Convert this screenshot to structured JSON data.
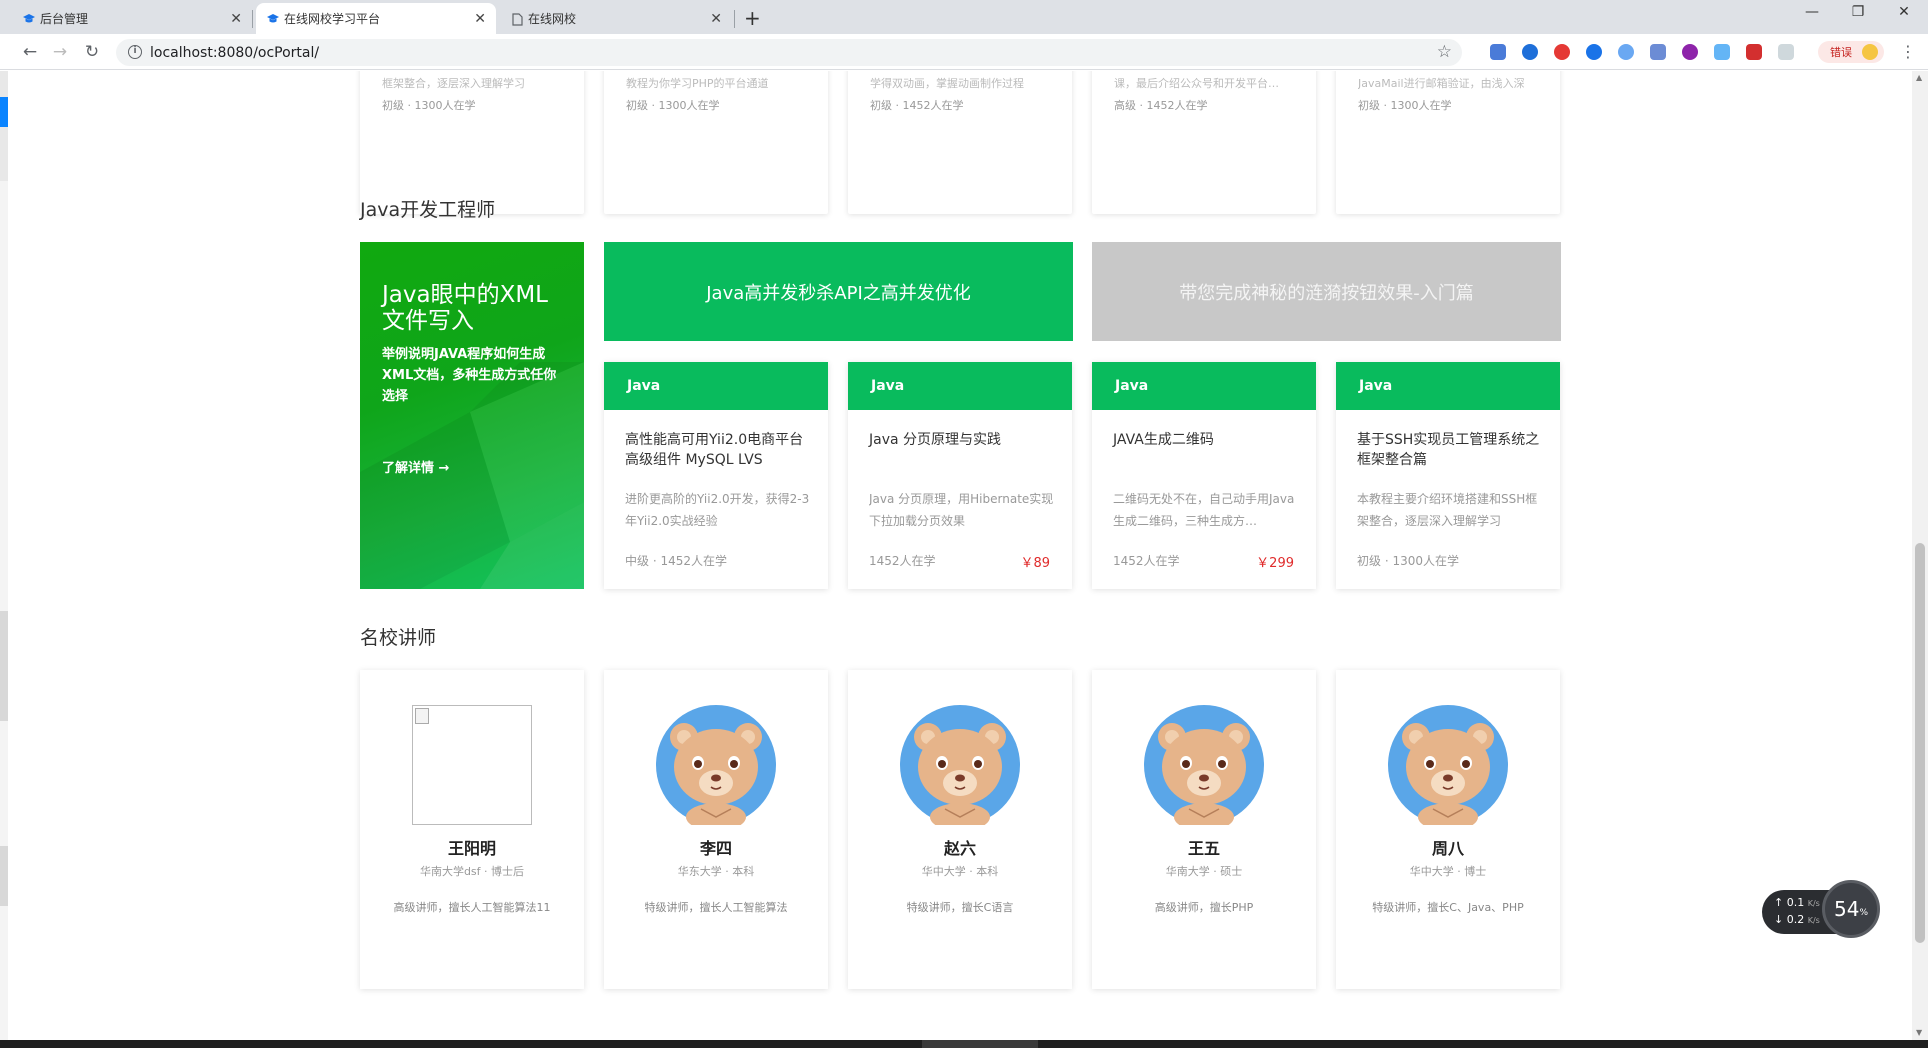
{
  "browser": {
    "tabs": [
      {
        "title": "后台管理"
      },
      {
        "title": "在线网校学习平台"
      },
      {
        "title": "在线网校"
      }
    ],
    "url": "localhost:8080/ocPortal/",
    "error_badge": "错误"
  },
  "top_row": {
    "cards": [
      {
        "desc": "框架整合，逐层深入理解学习",
        "level": "初级",
        "learners": "1300人在学"
      },
      {
        "desc": "教程为你学习PHP的平台通道",
        "level": "初级",
        "learners": "1300人在学"
      },
      {
        "desc": "学得双动画，掌握动画制作过程",
        "level": "初级",
        "learners": "1452人在学"
      },
      {
        "desc": "课，最后介绍公众号和开发平台…",
        "level": "高级",
        "learners": "1452人在学"
      },
      {
        "desc": "JavaMail进行邮箱验证，由浅入深",
        "level": "初级",
        "learners": "1300人在学"
      }
    ]
  },
  "java_section": {
    "title": "Java开发工程师",
    "promo": {
      "title": "Java眼中的XML 文件写入",
      "desc": "举例说明JAVA程序如何生成XML文档，多种生成方式任你选择",
      "link": "了解详情 →"
    },
    "banners": [
      {
        "text": "Java高并发秒杀API之高并发优化"
      },
      {
        "text": "带您完成神秘的涟漪按钮效果-入门篇"
      }
    ],
    "courses": [
      {
        "tag": "Java",
        "title": "高性能高可用Yii2.0电商平台 高级组件 MySQL LVS",
        "desc": "进阶更高阶的Yii2.0开发，获得2-3年Yii2.0实战经验",
        "meta": "中级 · 1452人在学",
        "price": ""
      },
      {
        "tag": "Java",
        "title": "Java 分页原理与实践",
        "desc": "Java 分页原理，用Hibernate实现下拉加载分页效果",
        "meta": "1452人在学",
        "price": "￥89"
      },
      {
        "tag": "Java",
        "title": "JAVA生成二维码",
        "desc": "二维码无处不在，自己动手用Java生成二维码，三种生成方…",
        "meta": "1452人在学",
        "price": "￥299"
      },
      {
        "tag": "Java",
        "title": "基于SSH实现员工管理系统之框架整合篇",
        "desc": "本教程主要介绍环境搭建和SSH框架整合，逐层深入理解学习",
        "meta": "初级 · 1300人在学",
        "price": ""
      }
    ]
  },
  "teachers_section": {
    "title": "名校讲师",
    "teachers": [
      {
        "name": "王阳明",
        "school": "华南大学dsf · 博士后",
        "intro": "高级讲师，擅长人工智能算法11",
        "avatar": "broken-image"
      },
      {
        "name": "李四",
        "school": "华东大学 · 本科",
        "intro": "特级讲师，擅长人工智能算法",
        "avatar": "bear"
      },
      {
        "name": "赵六",
        "school": "华中大学 · 本科",
        "intro": "特级讲师，擅长C语言",
        "avatar": "bear"
      },
      {
        "name": "王五",
        "school": "华南大学 · 硕士",
        "intro": "高级讲师，擅长PHP",
        "avatar": "bear"
      },
      {
        "name": "周八",
        "school": "华中大学 · 博士",
        "intro": "特级讲师，擅长C、Java、PHP",
        "avatar": "bear"
      }
    ]
  },
  "net_widget": {
    "up": "0.1",
    "down": "0.2",
    "unit": "K/s",
    "cpu": "54",
    "cpu_unit": "%"
  },
  "colors": {
    "accent_green": "#09bb5d",
    "price_red": "#e02b2b",
    "banner_gray": "#c8c8c8"
  }
}
